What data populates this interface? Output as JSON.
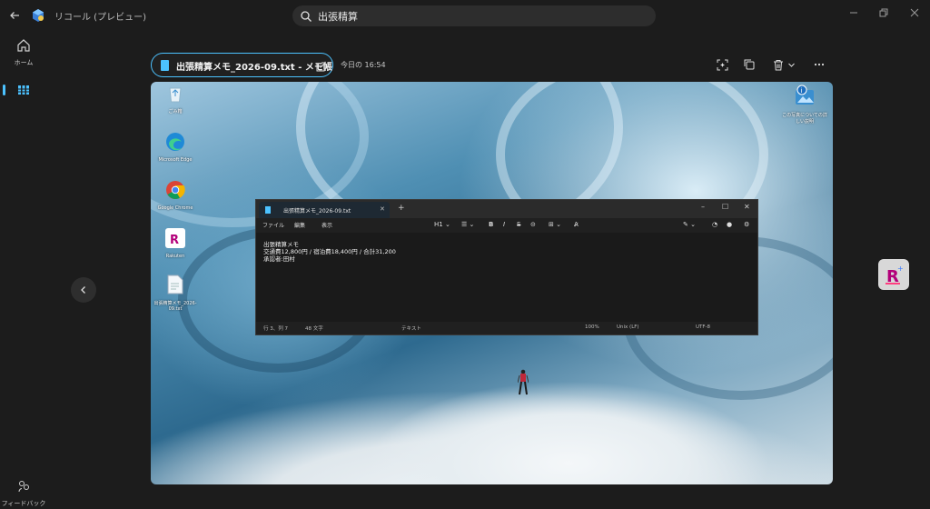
{
  "app": {
    "title": "リコール (プレビュー)",
    "search_value": "出張精算"
  },
  "rail": {
    "home_label": "ホーム",
    "feedback_label": "フィードバック"
  },
  "header": {
    "file_title": "出張精算メモ_2026-09.txt - メモ帳",
    "timestamp": "今日の 16:54"
  },
  "desktop": {
    "icons": [
      {
        "label": "ごみ箱"
      },
      {
        "label": "Microsoft Edge"
      },
      {
        "label": "Google Chrome"
      },
      {
        "label": "Rakuten"
      },
      {
        "label": "出張精算メモ_2026-09.txt"
      }
    ],
    "right_icon_label": "この写真についての詳しい説明"
  },
  "notepad": {
    "tab_title": "出張精算メモ_2026-09.txt",
    "menu": [
      "ファイル",
      "編集",
      "表示"
    ],
    "toolbar_heading": "H1",
    "content": [
      "出張精算メモ",
      "交通費12,800円 / 宿泊費18,400円 / 合計31,200",
      "承認者:田村"
    ],
    "status": {
      "position": "行 3、列 7",
      "chars": "48 文字",
      "format": "テキスト",
      "zoom": "100%",
      "line_ending": "Unix (LF)",
      "encoding": "UTF-8"
    }
  },
  "colors": {
    "accent": "#4cc2ff",
    "background": "#1c1c1c"
  }
}
